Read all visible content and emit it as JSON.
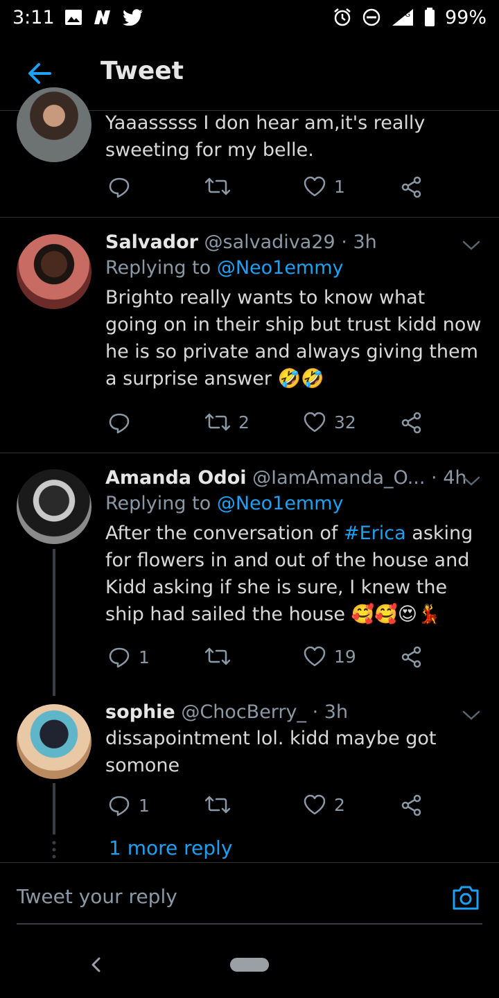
{
  "status_bar": {
    "time": "3:11",
    "network": "3G",
    "battery": "99%"
  },
  "app_bar": {
    "title": "Tweet"
  },
  "tweets": [
    {
      "text": "Yaaasssss I don hear am,it's really sweeting for my belle.",
      "replies": "",
      "retweets": "",
      "likes": "1"
    },
    {
      "name": "Salvador",
      "handle": "@salvadiva29",
      "time": "· 3h",
      "replying_prefix": "Replying to",
      "replying_to": "@Neo1emmy",
      "text": "Brighto really wants to know what going on in their ship but trust kidd now he is so private and always giving them a surprise answer 🤣🤣",
      "replies": "",
      "retweets": "2",
      "likes": "32"
    },
    {
      "name": "Amanda Odoi",
      "handle": "@IamAmanda_O...",
      "time": "· 4h",
      "replying_prefix": "Replying to",
      "replying_to": "@Neo1emmy",
      "text_before": "After the conversation of ",
      "hashtag": "#Erica",
      "text_after": " asking for flowers in and out of the house and Kidd asking if she is sure, I knew the ship had sailed the house 🥰🥰😍💃",
      "replies": "1",
      "retweets": "",
      "likes": "19"
    },
    {
      "name": "sophie",
      "handle": "@ChocBerry_",
      "time": "· 3h",
      "text": "dissapointment lol. kidd maybe got somone",
      "replies": "1",
      "retweets": "",
      "likes": "2"
    }
  ],
  "more_replies_label": "1 more reply",
  "reply_bar": {
    "placeholder": "Tweet your reply"
  },
  "colors": {
    "background": "#000000",
    "accent": "#1da1f2",
    "secondary_text": "#8b98a5"
  },
  "icons": [
    "back-arrow-icon",
    "reply-icon",
    "retweet-icon",
    "like-icon",
    "share-icon",
    "camera-icon",
    "chevron-down-icon"
  ]
}
